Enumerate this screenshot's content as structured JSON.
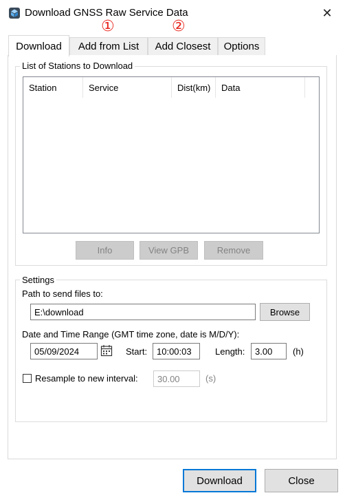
{
  "window": {
    "title": "Download GNSS Raw Service Data",
    "close_glyph": "✕"
  },
  "annotations": {
    "marker1": "①",
    "marker2": "②"
  },
  "tabs": [
    {
      "label": "Download",
      "active": true
    },
    {
      "label": "Add from List",
      "active": false
    },
    {
      "label": "Add Closest",
      "active": false
    },
    {
      "label": "Options",
      "active": false
    }
  ],
  "stations_group": {
    "legend": "List of Stations to Download",
    "columns": [
      "Station",
      "Service",
      "Dist(km)",
      "Data"
    ],
    "rows": [],
    "buttons": {
      "info": "Info",
      "view_gpb": "View GPB",
      "remove": "Remove"
    }
  },
  "settings": {
    "legend": "Settings",
    "path_label": "Path to send files to:",
    "path_value": "E:\\download",
    "browse_label": "Browse",
    "date_range_label": "Date and Time Range (GMT time zone, date is M/D/Y):",
    "date_value": "05/09/2024",
    "start_label": "Start:",
    "start_value": "10:00:03",
    "length_label": "Length:",
    "length_value": "3.00",
    "length_unit": "(h)",
    "resample_label": "Resample to new interval:",
    "resample_checked": false,
    "resample_value": "30.00",
    "resample_unit": "(s)"
  },
  "footer": {
    "download_label": "Download",
    "close_label": "Close"
  },
  "colors": {
    "accent": "#0078d7",
    "annotation": "#e8251b"
  }
}
